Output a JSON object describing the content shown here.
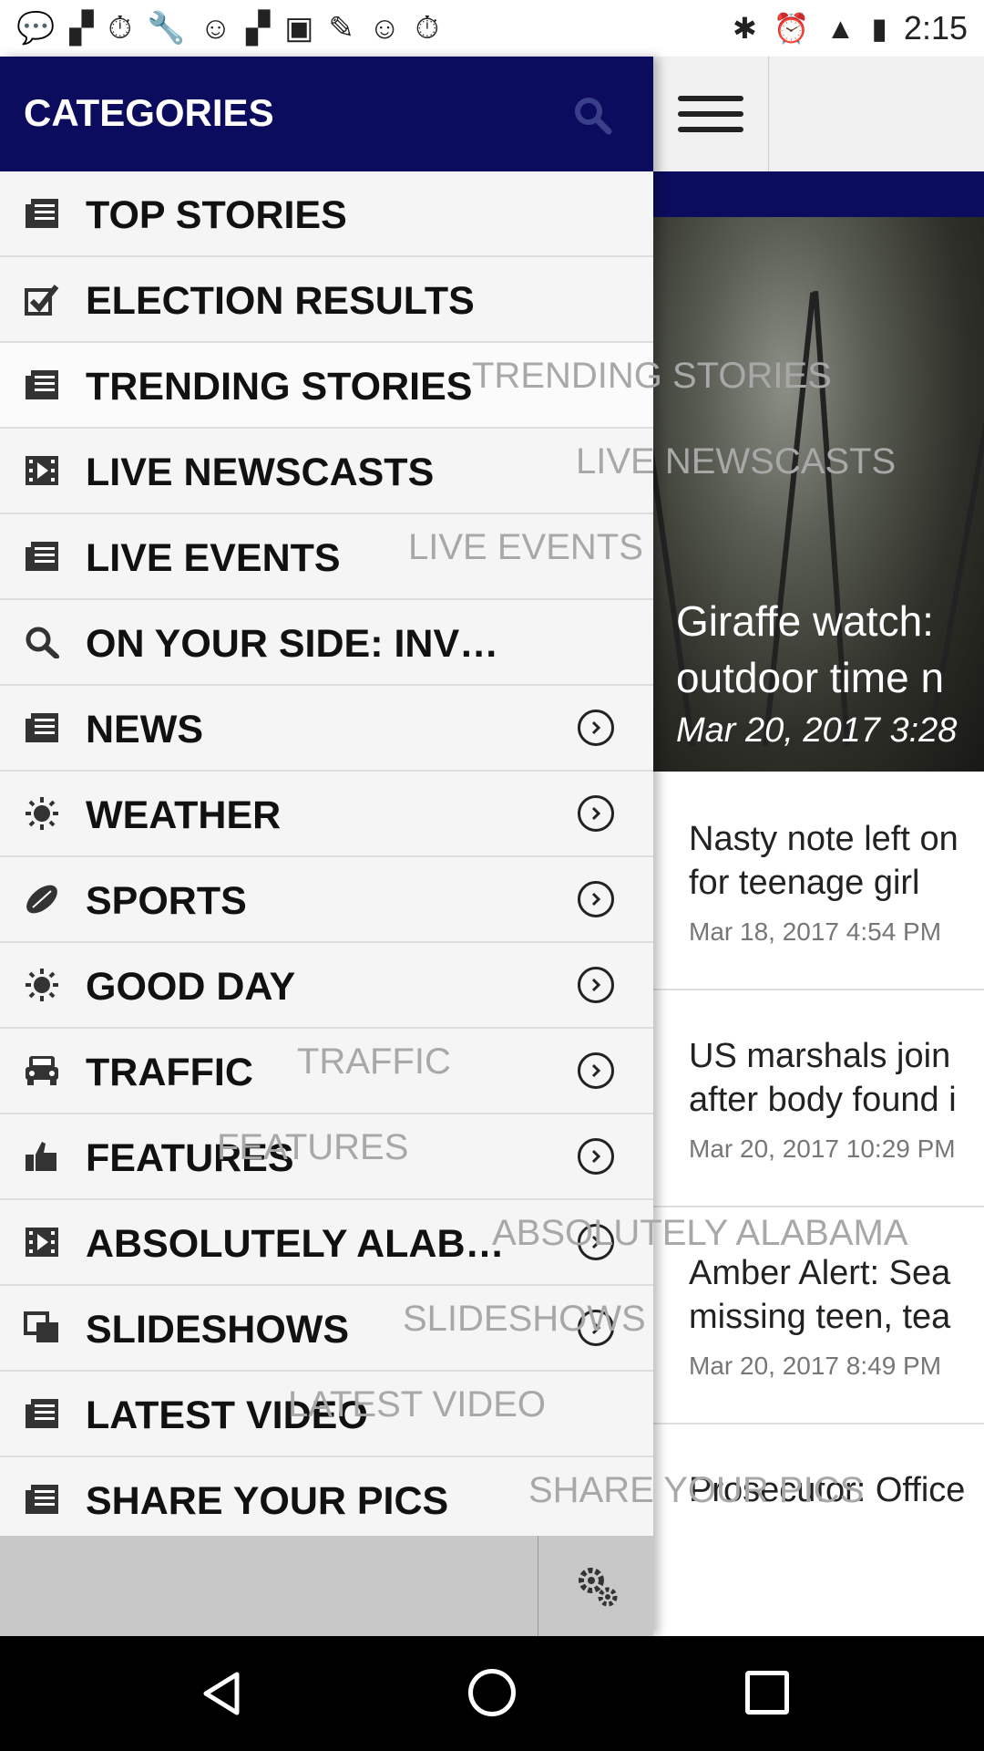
{
  "status_bar": {
    "time": "2:15",
    "left_icons": [
      "chat-icon",
      "flipboard-icon",
      "stopwatch-icon",
      "wrench-icon",
      "smiley-icon",
      "flipboard-icon",
      "qt-icon",
      "news-icon",
      "smiley-icon",
      "stopwatch-icon",
      "bluetooth-icon",
      "alarm-icon",
      "signal-icon",
      "battery-icon"
    ]
  },
  "drawer": {
    "title": "CATEGORIES",
    "items": [
      {
        "label": "TOP STORIES",
        "icon": "newspaper-icon",
        "arrow": false,
        "ghost": ""
      },
      {
        "label": "ELECTION RESULTS",
        "icon": "checkbox-icon",
        "arrow": false,
        "ghost": ""
      },
      {
        "label": "TRENDING STORIES",
        "icon": "newspaper-icon",
        "arrow": false,
        "ghost": "TRENDING STORIES"
      },
      {
        "label": "LIVE NEWSCASTS",
        "icon": "video-icon",
        "arrow": false,
        "ghost": "LIVE NEWSCASTS"
      },
      {
        "label": "LIVE EVENTS",
        "icon": "newspaper-icon",
        "arrow": false,
        "ghost": "LIVE EVENTS"
      },
      {
        "label": "ON YOUR SIDE: INVESTIGA…",
        "icon": "search-icon",
        "arrow": false,
        "ghost": ""
      },
      {
        "label": "NEWS",
        "icon": "newspaper-icon",
        "arrow": true,
        "ghost": ""
      },
      {
        "label": "WEATHER",
        "icon": "sun-icon",
        "arrow": true,
        "ghost": ""
      },
      {
        "label": "SPORTS",
        "icon": "football-icon",
        "arrow": true,
        "ghost": ""
      },
      {
        "label": "GOOD DAY",
        "icon": "sun-icon",
        "arrow": true,
        "ghost": ""
      },
      {
        "label": "TRAFFIC",
        "icon": "car-icon",
        "arrow": true,
        "ghost": "TRAFFIC"
      },
      {
        "label": "FEATURES",
        "icon": "thumbs-up-icon",
        "arrow": true,
        "ghost": "FEATURES"
      },
      {
        "label": "ABSOLUTELY ALABA…",
        "icon": "video-icon",
        "arrow": true,
        "ghost": "ABSOLUTELY ALABAMA"
      },
      {
        "label": "SLIDESHOWS",
        "icon": "slideshow-icon",
        "arrow": true,
        "ghost": "SLIDESHOWS"
      },
      {
        "label": "LATEST VIDEO",
        "icon": "newspaper-icon",
        "arrow": false,
        "ghost": "LATEST VIDEO"
      },
      {
        "label": "SHARE YOUR PICS",
        "icon": "newspaper-icon",
        "arrow": false,
        "ghost": "SHARE YOUR PICS"
      }
    ]
  },
  "feed": {
    "hero": {
      "title_line1": "Giraffe watch:",
      "title_line2": "outdoor time n",
      "date": "Mar 20, 2017 3:28"
    },
    "items": [
      {
        "line1": "Nasty note left on",
        "line2": "for teenage girl",
        "date": "Mar 18, 2017 4:54 PM"
      },
      {
        "line1": "US marshals join",
        "line2": "after body found i",
        "date": "Mar 20, 2017 10:29 PM"
      },
      {
        "line1": "Amber Alert: Sea",
        "line2": "missing teen, tea",
        "date": "Mar 20, 2017 8:49 PM"
      },
      {
        "line1": "Prosecutor: Office",
        "line2": "",
        "date": ""
      }
    ]
  },
  "colors": {
    "header_navy": "#0c0c5e",
    "drawer_bg": "#f5f5f5",
    "footer_gray": "#c8c8c8"
  }
}
